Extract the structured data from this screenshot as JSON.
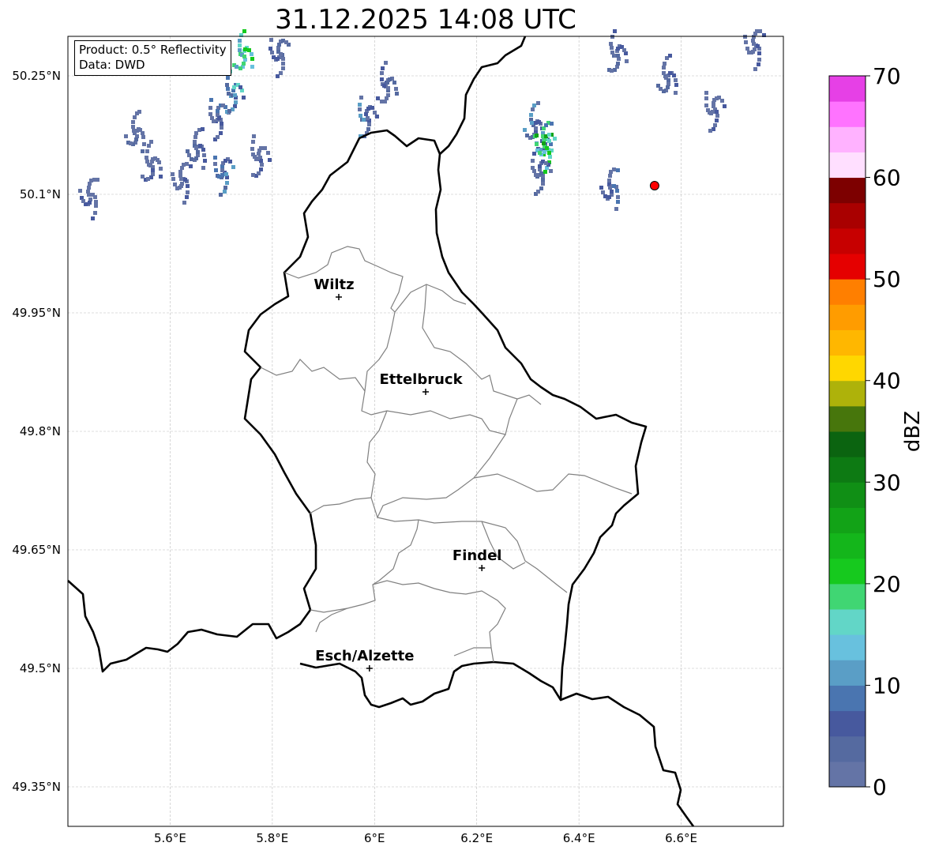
{
  "title": "31.12.2025 14:08 UTC",
  "info_box": {
    "product": "Product: 0.5° Reflectivity",
    "data": "Data: DWD"
  },
  "map": {
    "lon_range": [
      5.4,
      6.8
    ],
    "lat_range": [
      49.3,
      50.3
    ],
    "lat_ticks": [
      {
        "value": 50.25,
        "label": "50.25°N"
      },
      {
        "value": 50.1,
        "label": "50.1°N"
      },
      {
        "value": 49.95,
        "label": "49.95°N"
      },
      {
        "value": 49.8,
        "label": "49.8°N"
      },
      {
        "value": 49.65,
        "label": "49.65°N"
      },
      {
        "value": 49.5,
        "label": "49.5°N"
      },
      {
        "value": 49.35,
        "label": "49.35°N"
      }
    ],
    "lon_ticks": [
      {
        "value": 5.6,
        "label": "5.6°E"
      },
      {
        "value": 5.8,
        "label": "5.8°E"
      },
      {
        "value": 6.0,
        "label": "6°E"
      },
      {
        "value": 6.2,
        "label": "6.2°E"
      },
      {
        "value": 6.4,
        "label": "6.4°E"
      },
      {
        "value": 6.6,
        "label": "6.6°E"
      }
    ],
    "grid": true,
    "cities": [
      {
        "name": "Wiltz",
        "lon": 5.93,
        "lat": 49.97
      },
      {
        "name": "Ettelbruck",
        "lon": 6.1,
        "lat": 49.85
      },
      {
        "name": "Findel",
        "lon": 6.21,
        "lat": 49.627
      },
      {
        "name": "Esch/Alzette",
        "lon": 5.99,
        "lat": 49.5
      }
    ],
    "radar_site": {
      "lon": 6.548,
      "lat": 50.111,
      "color": "#ff0000"
    },
    "radar_cells": [
      {
        "lon": 5.69,
        "lat": 50.2,
        "dbz": 8
      },
      {
        "lon": 5.72,
        "lat": 50.23,
        "dbz": 15
      },
      {
        "lon": 5.74,
        "lat": 50.28,
        "dbz": 22
      },
      {
        "lon": 5.65,
        "lat": 50.16,
        "dbz": 6
      },
      {
        "lon": 5.62,
        "lat": 50.12,
        "dbz": 5
      },
      {
        "lon": 5.7,
        "lat": 50.13,
        "dbz": 12
      },
      {
        "lon": 5.77,
        "lat": 50.15,
        "dbz": 5
      },
      {
        "lon": 5.56,
        "lat": 50.14,
        "dbz": 5
      },
      {
        "lon": 5.53,
        "lat": 50.18,
        "dbz": 4
      },
      {
        "lon": 5.44,
        "lat": 50.1,
        "dbz": 5
      },
      {
        "lon": 5.81,
        "lat": 50.28,
        "dbz": 6
      },
      {
        "lon": 5.98,
        "lat": 50.2,
        "dbz": 10
      },
      {
        "lon": 6.02,
        "lat": 50.24,
        "dbz": 7
      },
      {
        "lon": 6.31,
        "lat": 50.19,
        "dbz": 10
      },
      {
        "lon": 6.33,
        "lat": 50.17,
        "dbz": 18
      },
      {
        "lon": 6.33,
        "lat": 50.16,
        "dbz": 25
      },
      {
        "lon": 6.32,
        "lat": 50.13,
        "dbz": 7
      },
      {
        "lon": 6.47,
        "lat": 50.28,
        "dbz": 7
      },
      {
        "lon": 6.57,
        "lat": 50.25,
        "dbz": 6
      },
      {
        "lon": 6.46,
        "lat": 50.11,
        "dbz": 8
      },
      {
        "lon": 6.74,
        "lat": 50.29,
        "dbz": 5
      },
      {
        "lon": 6.66,
        "lat": 50.21,
        "dbz": 5
      }
    ]
  },
  "colorbar": {
    "label": "dBZ",
    "min": 0,
    "max": 70,
    "ticks": [
      {
        "value": 0,
        "label": "0"
      },
      {
        "value": 10,
        "label": "10"
      },
      {
        "value": 20,
        "label": "20"
      },
      {
        "value": 30,
        "label": "30"
      },
      {
        "value": 40,
        "label": "40"
      },
      {
        "value": 50,
        "label": "50"
      },
      {
        "value": 60,
        "label": "60"
      },
      {
        "value": 70,
        "label": "70"
      }
    ],
    "colors": [
      "#6474a6",
      "#556aa0",
      "#47599e",
      "#4a75b0",
      "#5a9ec6",
      "#68c1de",
      "#62d6c7",
      "#40d673",
      "#16c91e",
      "#14b61b",
      "#12a317",
      "#108f15",
      "#0d7a13",
      "#0b6410",
      "#47760c",
      "#aeb20a",
      "#ffd700",
      "#ffb700",
      "#ff9c00",
      "#ff7f00",
      "#e50000",
      "#c70000",
      "#a90000",
      "#7d0000",
      "#ffdfff",
      "#ffb2ff",
      "#ff73ff",
      "#e640e6"
    ]
  }
}
